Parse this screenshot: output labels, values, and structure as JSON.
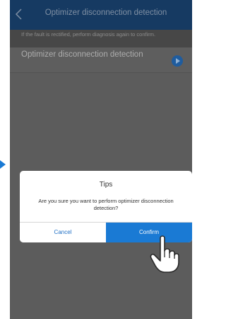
{
  "header": {
    "title": "Optimizer disconnection detection",
    "back_icon": "chevron-left-icon"
  },
  "hint": {
    "text": "If the fault is rectified, perform diagnosis again to confirm."
  },
  "list": {
    "item_label": "Optimizer disconnection detection",
    "item_icon": "play-icon"
  },
  "dialog": {
    "title": "Tips",
    "message": "Are you sure you want to perform optimizer disconnection detection?",
    "cancel_label": "Cancel",
    "confirm_label": "Confirm"
  },
  "pointer": {
    "icon": "hand-pointer-icon"
  },
  "side_marker": {
    "icon": "arrow-right-icon"
  },
  "colors": {
    "header_bg": "#163a62",
    "overlay": "#5c5c5c",
    "accent": "#1a7ad4",
    "link": "#1f6fc5"
  }
}
